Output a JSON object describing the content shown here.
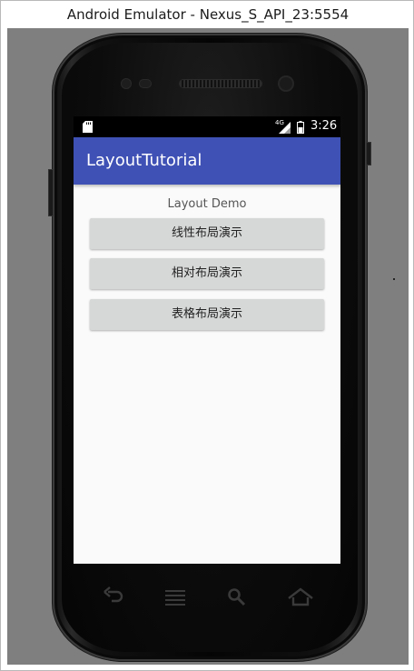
{
  "window": {
    "title": "Android Emulator - Nexus_S_API_23:5554"
  },
  "statusbar": {
    "network": "4G",
    "time": "3:26"
  },
  "app": {
    "title": "LayoutTutorial",
    "heading": "Layout Demo",
    "buttons": [
      {
        "label": "线性布局演示"
      },
      {
        "label": "相对布局演示"
      },
      {
        "label": "表格布局演示"
      }
    ]
  },
  "nav": {
    "icons": [
      "back-icon",
      "menu-icon",
      "search-icon",
      "home-icon"
    ]
  },
  "colors": {
    "appbar": "#3f51b5",
    "button": "#d6d7d7",
    "background": "#fafafa",
    "stage": "#7f7f7f"
  }
}
